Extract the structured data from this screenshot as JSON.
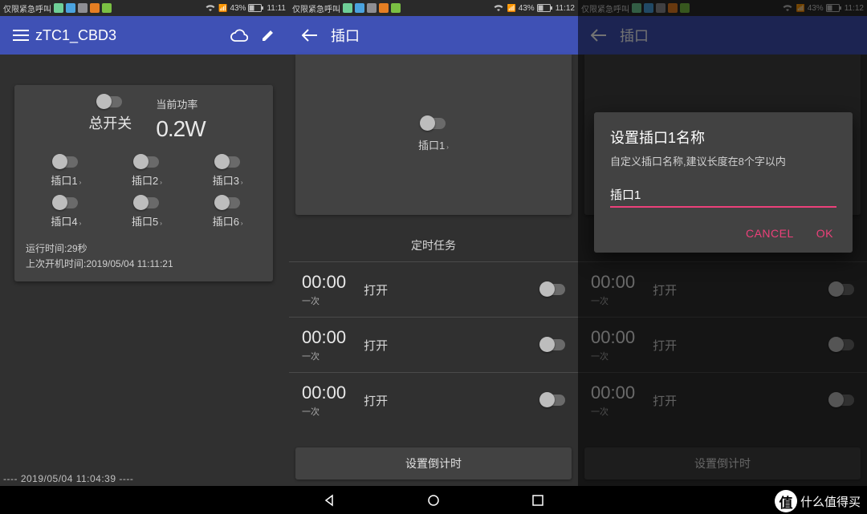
{
  "status": {
    "carrier": "仅限紧急呼叫",
    "battery": "43%",
    "times": [
      "11:11",
      "11:12",
      "11:12"
    ],
    "sq_colors": [
      "#6fcf97",
      "#4aa3df",
      "#8e8e93",
      "#e67e22",
      "#7bc043"
    ]
  },
  "p1": {
    "title": "zTC1_CBD3",
    "power_label": "当前功率",
    "power_value": "0.2W",
    "master_label": "总开关",
    "sockets": [
      "插口1",
      "插口2",
      "插口3",
      "插口4",
      "插口5",
      "插口6"
    ],
    "runtime": "运行时间:29秒",
    "last_boot": "上次开机时间:2019/05/04 11:11:21",
    "screenshot_ts": "---- 2019/05/04 11:04:39 ----"
  },
  "p2": {
    "title": "插口",
    "hero_label": "插口1",
    "section_title": "定时任务",
    "tasks": [
      {
        "time": "00:00",
        "freq": "一次",
        "action": "打开"
      },
      {
        "time": "00:00",
        "freq": "一次",
        "action": "打开"
      },
      {
        "time": "00:00",
        "freq": "一次",
        "action": "打开"
      }
    ],
    "countdown_label": "设置倒计时"
  },
  "p3": {
    "title": "插口",
    "dialog_title": "设置插口1名称",
    "dialog_msg": "自定义插口名称,建议长度在8个字以内",
    "input_value": "插口1",
    "cancel": "CANCEL",
    "ok": "OK"
  },
  "watermark": "什么值得买"
}
